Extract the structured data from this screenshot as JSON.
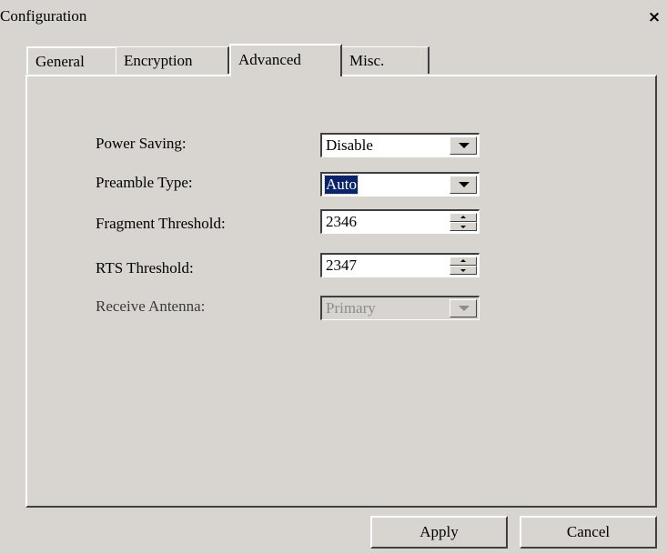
{
  "window": {
    "title": "Configuration",
    "close_glyph": "×"
  },
  "tabs": [
    {
      "label": "General"
    },
    {
      "label": "Encryption"
    },
    {
      "label": "Advanced",
      "selected": true
    },
    {
      "label": "Misc."
    }
  ],
  "fields": {
    "power_saving": {
      "label": "Power Saving:",
      "value": "Disable"
    },
    "preamble_type": {
      "label": "Preamble Type:",
      "value": "Auto"
    },
    "fragment_threshold": {
      "label": "Fragment Threshold:",
      "value": "2346"
    },
    "rts_threshold": {
      "label": "RTS Threshold:",
      "value": "2347"
    },
    "receive_antenna": {
      "label": "Receive Antenna:",
      "value": "Primary",
      "disabled": true
    }
  },
  "buttons": {
    "apply": "Apply",
    "cancel": "Cancel"
  },
  "icons": {
    "close": "close-icon",
    "dropdown": "chevron-down-icon",
    "spin_up": "spin-up-icon",
    "spin_down": "spin-down-icon"
  },
  "colors": {
    "dialog_bg": "#d8d4d0",
    "selection": "#0a246a",
    "field_bg": "#ffffff",
    "disabled_text": "#8c8c8c"
  }
}
